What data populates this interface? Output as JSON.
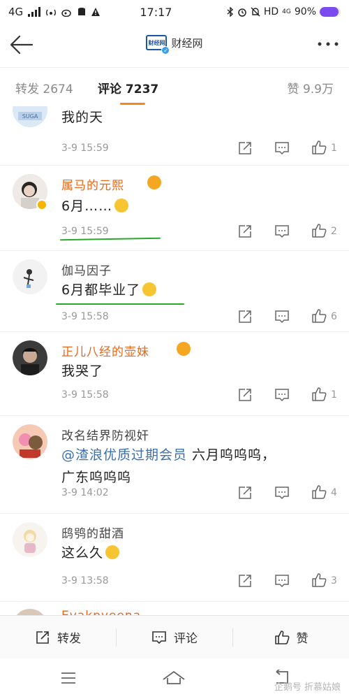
{
  "status_bar": {
    "network": "4G",
    "network2": "4G",
    "time": "17:17",
    "hd": "HD",
    "battery_text": "90%",
    "battery_level": 0.9,
    "battery_color": "#7a4cf0"
  },
  "header": {
    "logo_text": "财经网",
    "title": "财经网"
  },
  "tabs": {
    "forward_label": "转发",
    "forward_count": "2674",
    "comment_label": "评论",
    "comment_count": "7237",
    "like_label": "赞",
    "like_count": "9.9万",
    "active_color": "#f08a1c"
  },
  "comments": [
    {
      "username": "",
      "text": "我的天",
      "time": "3-9 15:59",
      "likes": "1",
      "name_style": "vip"
    },
    {
      "username": "属马的元熙",
      "text": "6月……",
      "time": "3-9 15:59",
      "likes": "2",
      "name_style": "vip"
    },
    {
      "username": "伽马因子",
      "text": "6月都毕业了",
      "time": "3-9 15:58",
      "likes": "6",
      "name_style": "normal"
    },
    {
      "username": "正儿八经的壶妹",
      "text": "我哭了",
      "time": "3-9 15:58",
      "likes": "1",
      "name_style": "vip"
    },
    {
      "username": "改名结界防视奸",
      "mention": "@渣浪优质过期会员",
      "text": " 六月呜呜呜，",
      "text2": "广东呜呜呜",
      "time": "3-9 14:02",
      "likes": "4",
      "name_style": "normal"
    },
    {
      "username": "鸱鸮的甜酒",
      "text": "这么久",
      "time": "3-9 13:58",
      "likes": "3",
      "name_style": "normal"
    },
    {
      "username": "Evakpyeena",
      "name_style": "vip"
    }
  ],
  "action_bar": {
    "forward": "转发",
    "comment": "评论",
    "like": "赞"
  },
  "watermark": "企鹅号 折慕姑娘",
  "colors": {
    "vip_name": "#e8671a",
    "mention": "#3a6fb0",
    "annotation_line": "#2aa82a"
  }
}
